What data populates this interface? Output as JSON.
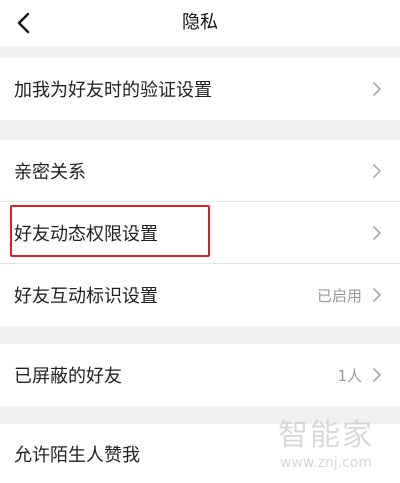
{
  "header": {
    "title": "隐私",
    "back_icon": "chevron-left-icon"
  },
  "sections": [
    {
      "rows": [
        {
          "label": "加我为好友时的验证设置",
          "value": "",
          "chevron": "chevron-right-icon"
        }
      ]
    },
    {
      "rows": [
        {
          "label": "亲密关系",
          "value": "",
          "chevron": "chevron-right-icon"
        },
        {
          "label": "好友动态权限设置",
          "value": "",
          "chevron": "chevron-right-icon",
          "highlighted": true
        },
        {
          "label": "好友互动标识设置",
          "value": "已启用",
          "chevron": "chevron-right-icon"
        }
      ]
    },
    {
      "rows": [
        {
          "label": "已屏蔽的好友",
          "value": "1人",
          "chevron": "chevron-right-icon"
        }
      ]
    },
    {
      "rows": [
        {
          "label": "允许陌生人赞我",
          "value": ""
        }
      ]
    }
  ],
  "watermark": {
    "main": "智能家",
    "sub": "www.znj.com"
  },
  "colors": {
    "highlight_border": "#e02020",
    "section_gap": "#f0f0f0",
    "value_text": "#999999"
  }
}
